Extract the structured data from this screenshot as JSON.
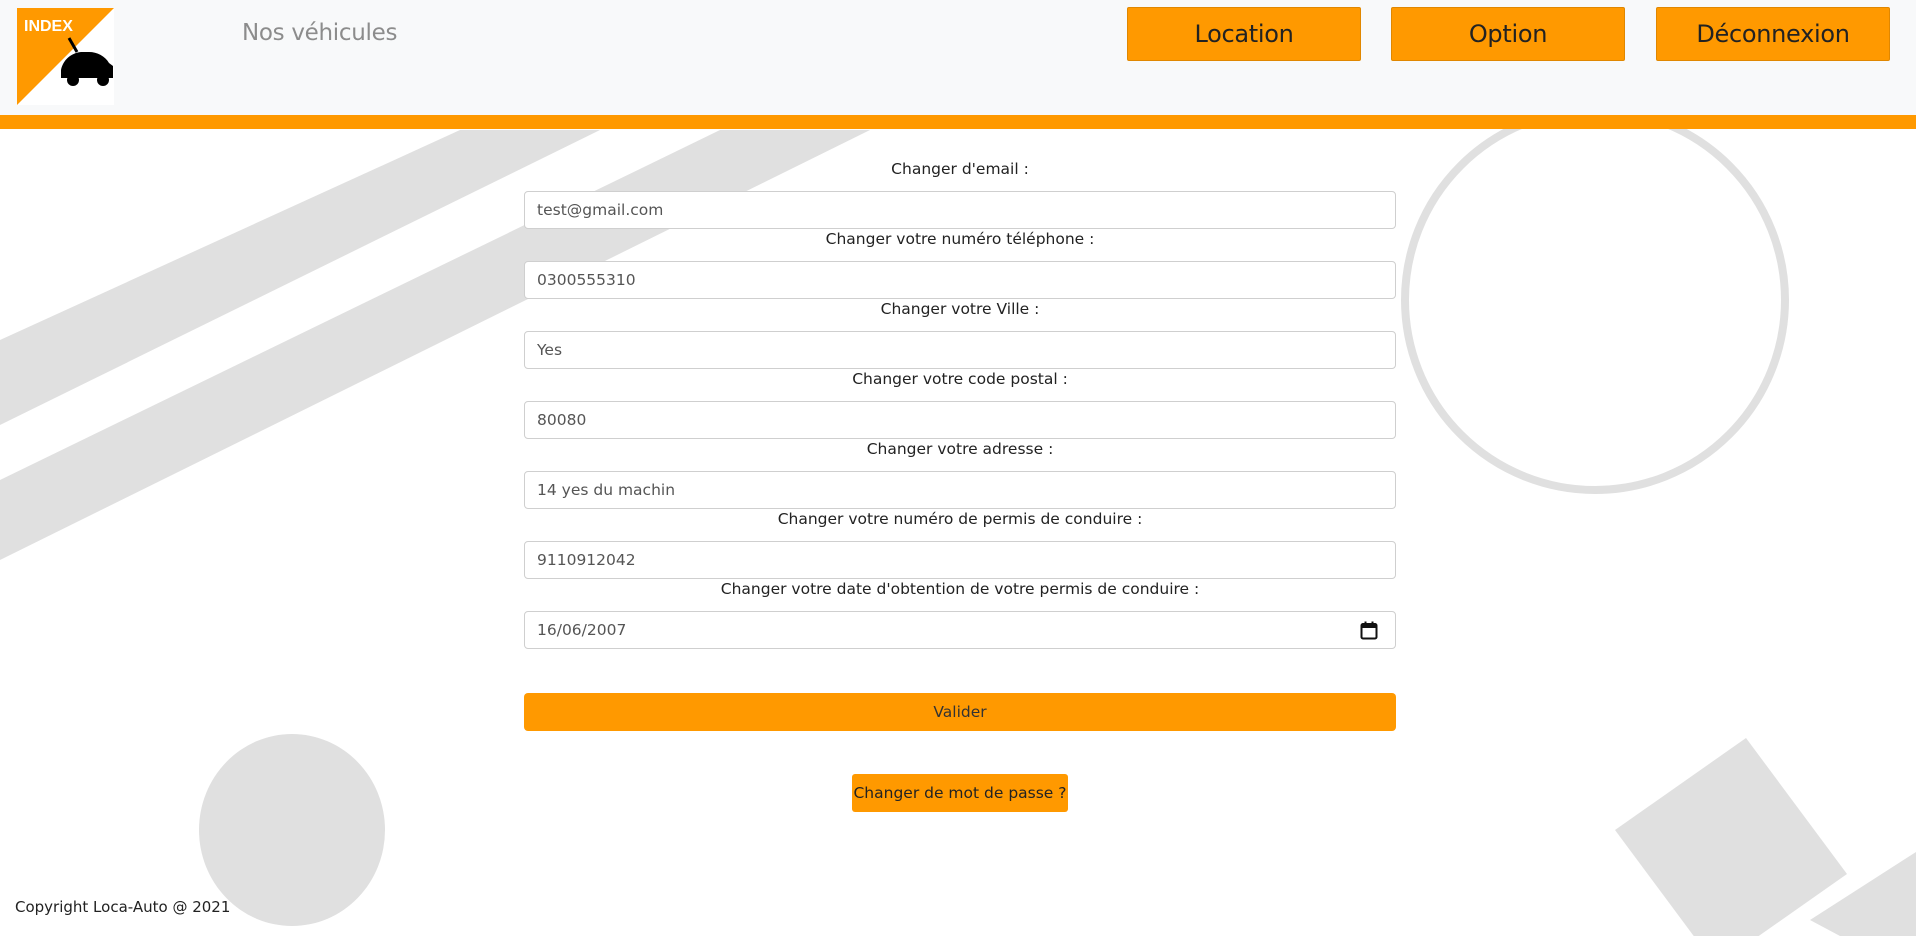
{
  "colors": {
    "accent": "#ff9900",
    "header_bg": "#f8f9fa",
    "shape_gray": "#e0e0e0"
  },
  "header": {
    "logo_text": "INDEX",
    "logo_icon": "car-icon",
    "brand_link": "Nos véhicules",
    "nav": [
      {
        "label": "Location"
      },
      {
        "label": "Option"
      },
      {
        "label": "Déconnexion"
      }
    ]
  },
  "form": {
    "fields": [
      {
        "label": "Changer d'email :",
        "value": "test@gmail.com"
      },
      {
        "label": "Changer votre numéro téléphone :",
        "value": "0300555310"
      },
      {
        "label": "Changer votre Ville :",
        "value": "Yes"
      },
      {
        "label": "Changer votre code postal :",
        "value": "80080"
      },
      {
        "label": "Changer votre adresse :",
        "value": "14 yes du machin"
      },
      {
        "label": "Changer votre numéro de permis de conduire :",
        "value": "9110912042"
      },
      {
        "label": "Changer votre date d'obtention de votre permis de conduire :",
        "value": "16/06/2007",
        "icon": "calendar-icon"
      }
    ],
    "submit_label": "Valider"
  },
  "change_password_label": "Changer de mot de passe ?",
  "footer": {
    "copyright": "Copyright Loca-Auto @ 2021"
  }
}
